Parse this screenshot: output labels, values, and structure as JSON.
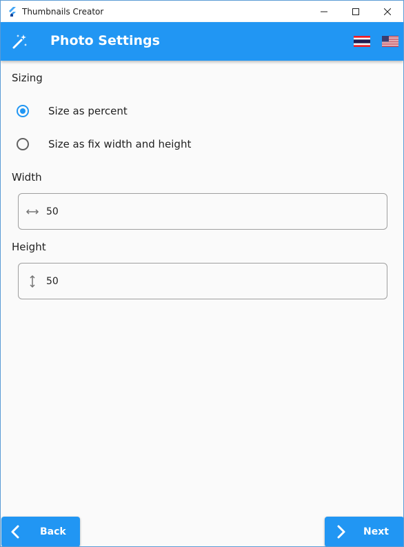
{
  "window": {
    "title": "Thumbnails Creator",
    "controls": {
      "minimize": "—",
      "maximize": "☐",
      "close": "✕"
    }
  },
  "appbar": {
    "title": "Photo Settings",
    "icon": "magic-wand-icon",
    "flags": [
      "thai-flag-icon",
      "us-flag-icon"
    ],
    "color": "#2196f3"
  },
  "sizing": {
    "label": "Sizing",
    "options": [
      {
        "label": "Size as percent",
        "selected": true
      },
      {
        "label": "Size as fix width and height",
        "selected": false
      }
    ]
  },
  "width": {
    "label": "Width",
    "value": "50",
    "icon": "horizontal-arrows-icon"
  },
  "height": {
    "label": "Height",
    "value": "50",
    "icon": "vertical-arrows-icon"
  },
  "nav": {
    "back_label": "Back",
    "next_label": "Next"
  }
}
